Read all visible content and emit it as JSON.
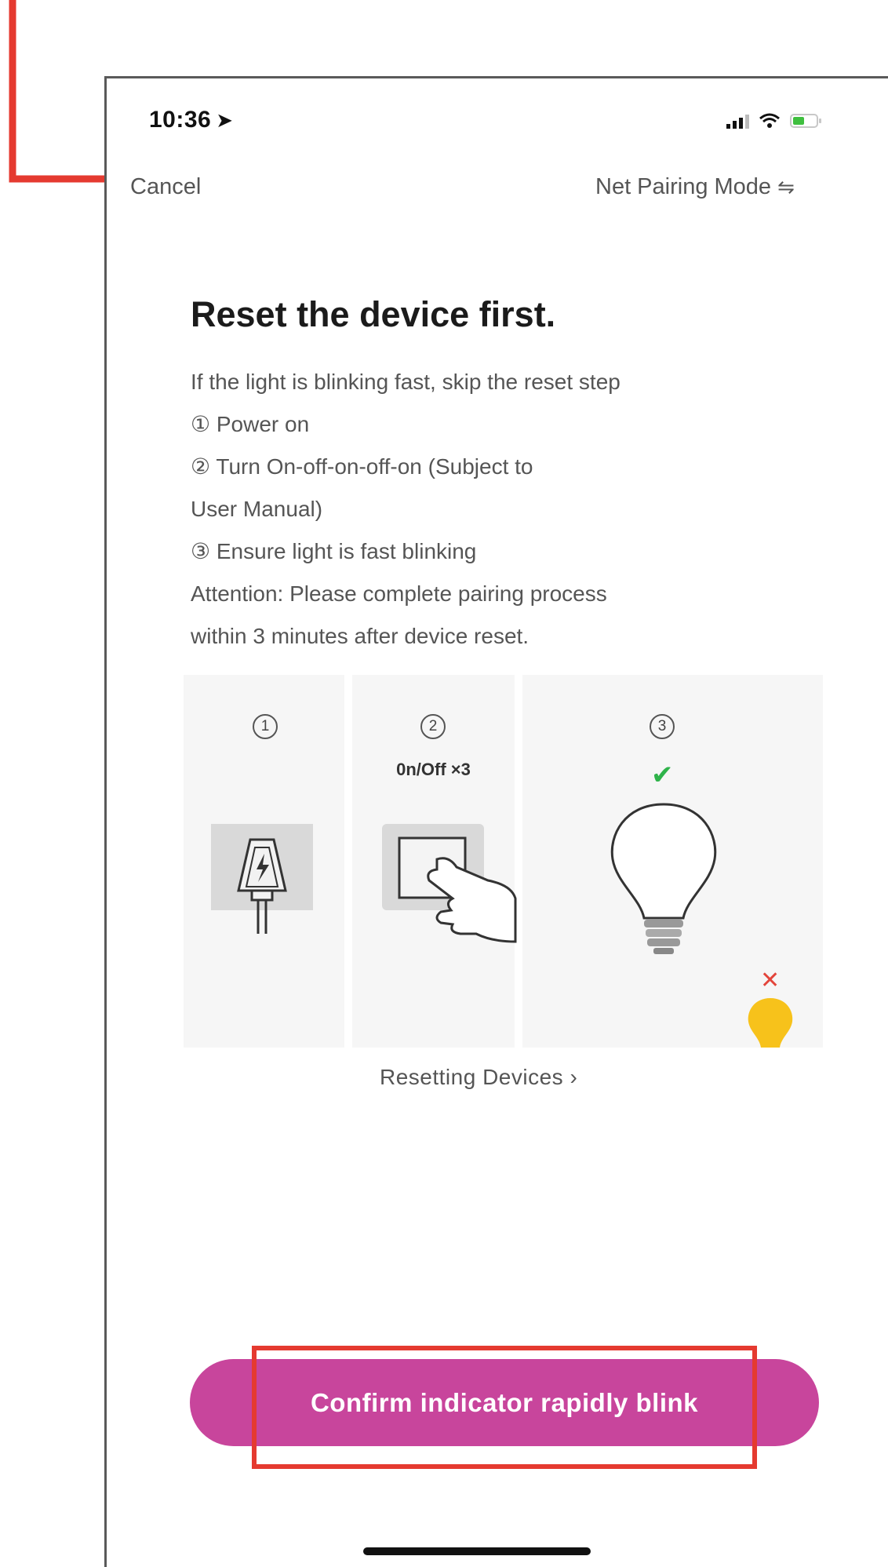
{
  "status_bar": {
    "time": "10:36"
  },
  "nav": {
    "cancel_label": "Cancel",
    "mode_label": "Net Pairing Mode"
  },
  "title": "Reset the device first.",
  "instructions": [
    "If the light is blinking fast, skip the reset step",
    "① Power on",
    "② Turn On-off-on-off-on (Subject to",
    "User Manual)",
    "③ Ensure light is fast blinking",
    "Attention: Please complete pairing process",
    "within 3 minutes after device reset."
  ],
  "illustration": {
    "steps": [
      "1",
      "2",
      "3"
    ],
    "onoff_label": "0n/Off ×3"
  },
  "resetting_link": "Resetting Devices",
  "confirm_button": "Confirm indicator rapidly blink",
  "colors": {
    "accent": "#c8459c",
    "annotation": "#e53a30",
    "check": "#2fb34a",
    "bulb_yellow": "#f7c21b"
  }
}
